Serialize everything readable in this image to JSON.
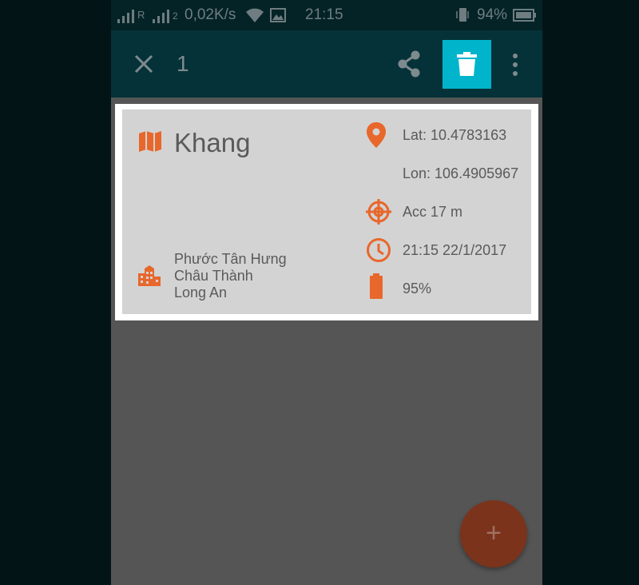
{
  "status_bar": {
    "network_speed": "0,02K/s",
    "time": "21:15",
    "battery": "94%",
    "icons": [
      "signal-icon",
      "signal-icon",
      "wifi-icon",
      "image-icon",
      "vibrate-icon",
      "battery-icon"
    ]
  },
  "app_bar": {
    "selected_count": "1",
    "icons": [
      "close-icon",
      "share-icon",
      "delete-icon",
      "more-vert-icon"
    ],
    "accent_color": "#00b4cc"
  },
  "card": {
    "name": "Khang",
    "address_lines": [
      "Phước Tân Hưng",
      "Châu Thành",
      "Long An"
    ],
    "lat": "Lat: 10.4783163",
    "lon": "Lon: 106.4905967",
    "accuracy": "Acc 17 m",
    "datetime": "21:15 22/1/2017",
    "battery": "95%",
    "icon_color": "#e8672b",
    "icons": [
      "map-icon",
      "location-icon",
      "accuracy-icon",
      "clock-icon",
      "battery-icon",
      "city-icon"
    ]
  },
  "fab": {
    "label": "+"
  }
}
